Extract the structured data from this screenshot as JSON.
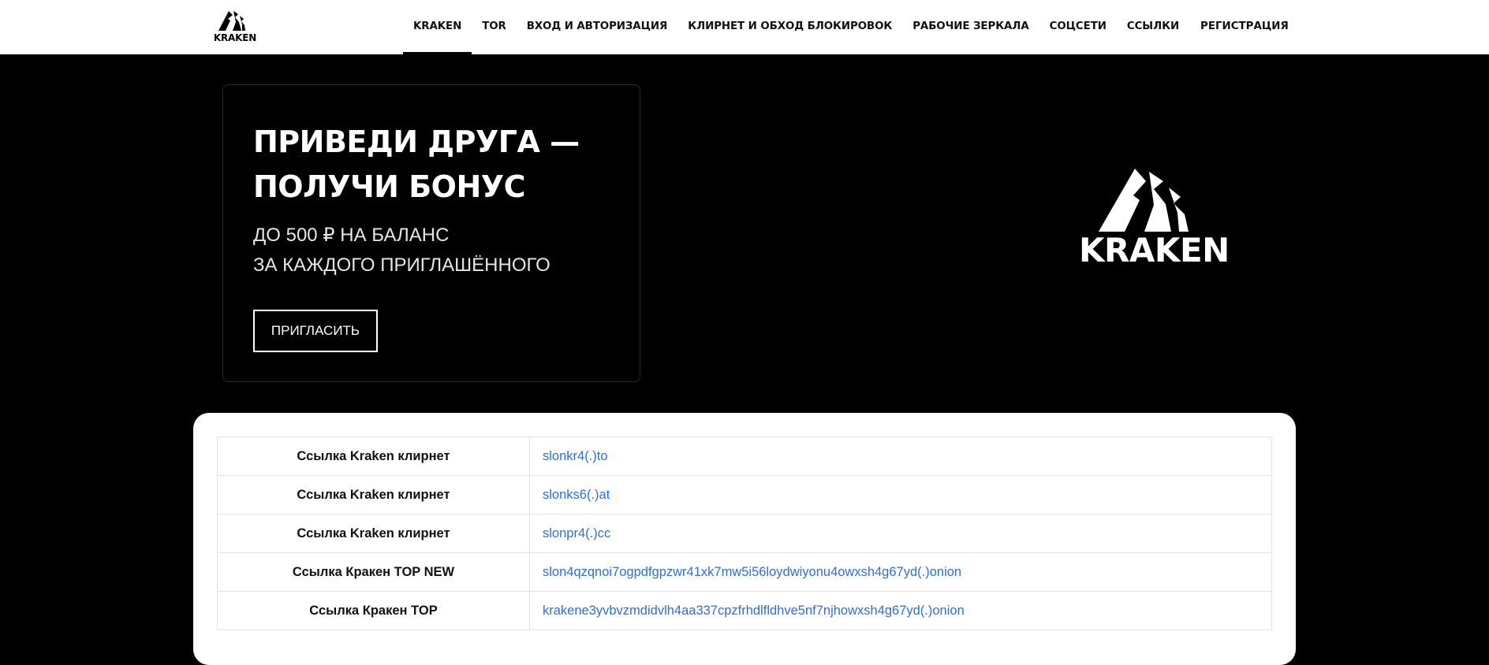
{
  "header": {
    "logo_text": "KRAKEN",
    "nav": [
      {
        "label": "KRAKEN",
        "active": true
      },
      {
        "label": "TOR",
        "active": false
      },
      {
        "label": "ВХОД И АВТОРИЗАЦИЯ",
        "active": false
      },
      {
        "label": "КЛИРНЕТ И ОБХОД БЛОКИРОВОК",
        "active": false
      },
      {
        "label": "РАБОЧИЕ ЗЕРКАЛА",
        "active": false
      },
      {
        "label": "СОЦСЕТИ",
        "active": false
      },
      {
        "label": "ССЫЛКИ",
        "active": false
      }
    ],
    "register_label": "РЕГИСТРАЦИЯ"
  },
  "promo": {
    "title_line1": "ПРИВЕДИ ДРУГА —",
    "title_line2": "ПОЛУЧИ БОНУС",
    "subtitle_line1": "ДО 500 ₽ НА БАЛАНС",
    "subtitle_line2": "ЗА КАЖДОГО ПРИГЛАШЁННОГО",
    "button_label": "ПРИГЛАСИТЬ"
  },
  "hero_logo_text": "KRAKEN",
  "links_table": [
    {
      "label": "Ссылка Kraken клирнет",
      "link": "slonkr4(.)to"
    },
    {
      "label": "Ссылка Kraken клирнет",
      "link": "slonks6(.)at"
    },
    {
      "label": "Ссылка Kraken клирнет",
      "link": "slonpr4(.)cc"
    },
    {
      "label": "Ссылка Кракен TOP NEW",
      "link": "slon4qzqnoi7ogpdfgpzwr41xk7mw5i56loydwiyonu4owxsh4g67yd(.)onion"
    },
    {
      "label": "Ссылка Кракен TOP",
      "link": "krakene3yvbvzmdidvlh4aa337cpzfrhdlfldhve5nf7njhowxsh4g67yd(.)onion"
    }
  ],
  "icons": {
    "logo": "kraken-logo-icon"
  },
  "colors": {
    "link": "#2f6fd8",
    "background": "#000000",
    "header_bg": "#ffffff"
  }
}
